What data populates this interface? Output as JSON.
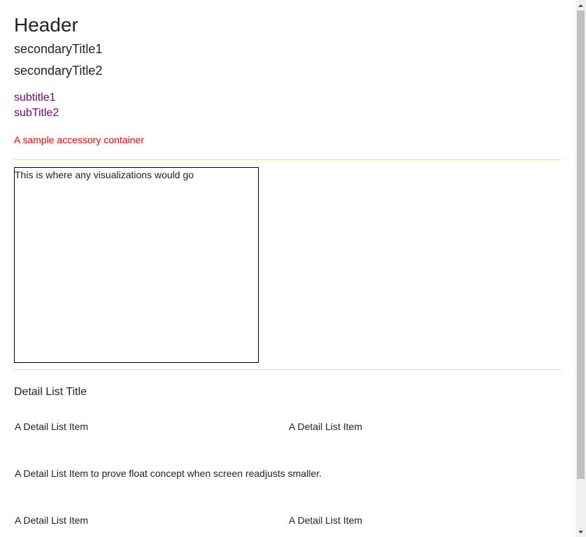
{
  "header": {
    "title": "Header"
  },
  "titles": {
    "secondary_1": "secondaryTitle1",
    "secondary_2": "secondaryTitle2",
    "subtitle_1": "subtitle1",
    "subtitle_2": "subTitle2"
  },
  "accessory": {
    "text": "A sample accessory container"
  },
  "visualization": {
    "placeholder_text": "This is where any visualizations would go"
  },
  "detail_list": {
    "title": "Detail List Title",
    "items": [
      "A Detail List Item",
      "A Detail List Item",
      "A Detail List Item to prove float concept when screen readjusts smaller.",
      "A Detail List Item",
      "A Detail List Item"
    ]
  },
  "scrollbar": {
    "up_icon": "triangle-up",
    "down_icon": "triangle-down"
  },
  "colors": {
    "text": "#222222",
    "subtitle": "#800080",
    "accessory": "#ff0000",
    "divider": "#f1e84b",
    "viz_border": "#000000",
    "scroll_track": "#f1f1f1",
    "scroll_thumb": "#c1c1c1"
  }
}
